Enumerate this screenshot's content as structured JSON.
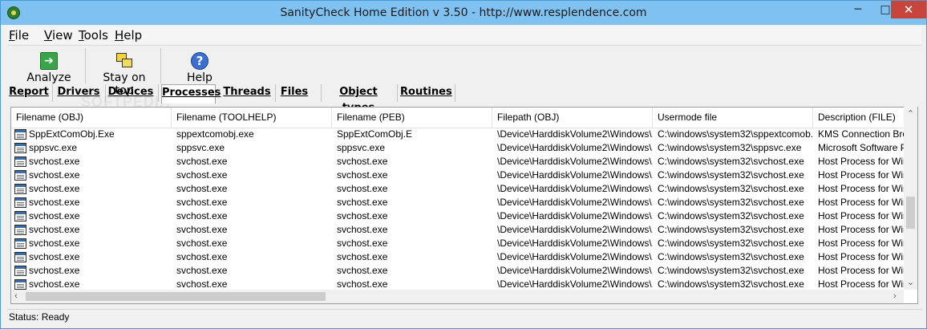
{
  "window": {
    "title": "SanityCheck Home Edition  v 3.50   -   http://www.resplendence.com",
    "minimize_glyph": "─",
    "maximize_glyph": "□",
    "close_glyph": "✕"
  },
  "menu": {
    "items": [
      {
        "accel": "F",
        "rest": "ile"
      },
      {
        "accel": "V",
        "rest": "iew"
      },
      {
        "accel": "T",
        "rest": "ools"
      },
      {
        "accel": "H",
        "rest": "elp"
      }
    ]
  },
  "toolbar": {
    "analyze_label": "Analyze",
    "stay_on_top_label": "Stay on top",
    "help_label": "Help",
    "watermark": "SOFTPEDIA"
  },
  "tabs": [
    {
      "label": "Report",
      "active": false
    },
    {
      "label": "Drivers",
      "active": false
    },
    {
      "label": "Devices",
      "active": false
    },
    {
      "label": "Processes",
      "active": true
    },
    {
      "label": "Threads",
      "active": false
    },
    {
      "label": "Files",
      "active": false
    },
    {
      "label": "Object types",
      "active": false
    },
    {
      "label": "Routines",
      "active": false
    }
  ],
  "grid": {
    "columns": [
      "Filename (OBJ)",
      "Filename (TOOLHELP)",
      "Filename (PEB)",
      "Filepath (OBJ)",
      "Usermode file",
      "Description (FILE)"
    ],
    "rows": [
      [
        "SppExtComObj.Exe",
        "sppextcomobj.exe",
        "SppExtComObj.E",
        "\\Device\\HarddiskVolume2\\Windows\\...",
        "C:\\windows\\system32\\sppextcomob...",
        "KMS Connection Broker"
      ],
      [
        "sppsvc.exe",
        "sppsvc.exe",
        "sppsvc.exe",
        "\\Device\\HarddiskVolume2\\Windows\\...",
        "C:\\windows\\system32\\sppsvc.exe",
        "Microsoft Software Protection"
      ],
      [
        "svchost.exe",
        "svchost.exe",
        "svchost.exe",
        "\\Device\\HarddiskVolume2\\Windows\\...",
        "C:\\windows\\system32\\svchost.exe",
        "Host Process for Windows"
      ],
      [
        "svchost.exe",
        "svchost.exe",
        "svchost.exe",
        "\\Device\\HarddiskVolume2\\Windows\\...",
        "C:\\windows\\system32\\svchost.exe",
        "Host Process for Windows"
      ],
      [
        "svchost.exe",
        "svchost.exe",
        "svchost.exe",
        "\\Device\\HarddiskVolume2\\Windows\\...",
        "C:\\windows\\system32\\svchost.exe",
        "Host Process for Windows"
      ],
      [
        "svchost.exe",
        "svchost.exe",
        "svchost.exe",
        "\\Device\\HarddiskVolume2\\Windows\\...",
        "C:\\windows\\system32\\svchost.exe",
        "Host Process for Windows"
      ],
      [
        "svchost.exe",
        "svchost.exe",
        "svchost.exe",
        "\\Device\\HarddiskVolume2\\Windows\\...",
        "C:\\windows\\system32\\svchost.exe",
        "Host Process for Windows"
      ],
      [
        "svchost.exe",
        "svchost.exe",
        "svchost.exe",
        "\\Device\\HarddiskVolume2\\Windows\\...",
        "C:\\windows\\system32\\svchost.exe",
        "Host Process for Windows"
      ],
      [
        "svchost.exe",
        "svchost.exe",
        "svchost.exe",
        "\\Device\\HarddiskVolume2\\Windows\\...",
        "C:\\windows\\system32\\svchost.exe",
        "Host Process for Windows"
      ],
      [
        "svchost.exe",
        "svchost.exe",
        "svchost.exe",
        "\\Device\\HarddiskVolume2\\Windows\\...",
        "C:\\windows\\system32\\svchost.exe",
        "Host Process for Windows"
      ],
      [
        "svchost.exe",
        "svchost.exe",
        "svchost.exe",
        "\\Device\\HarddiskVolume2\\Windows\\...",
        "C:\\windows\\system32\\svchost.exe",
        "Host Process for Windows"
      ],
      [
        "svchost.exe",
        "svchost.exe",
        "svchost.exe",
        "\\Device\\HarddiskVolume2\\Windows\\...",
        "C:\\windows\\system32\\svchost.exe",
        "Host Process for Windows"
      ]
    ]
  },
  "scrollbars": {
    "up_arrow": "⌃",
    "down_arrow": "⌄",
    "left_arrow": "‹",
    "right_arrow": "›"
  },
  "status": {
    "text": "Status: Ready"
  }
}
